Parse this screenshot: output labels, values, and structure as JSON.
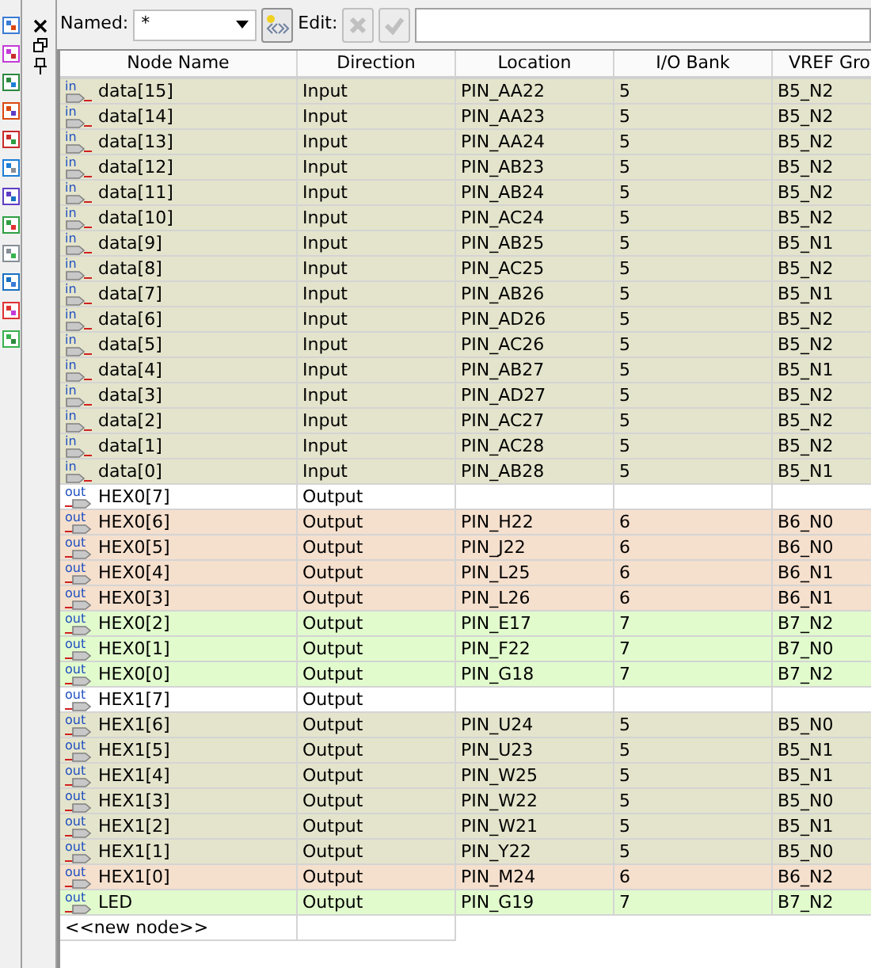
{
  "toolbar": {
    "named_label": "Named:",
    "named_value": "*",
    "edit_label": "Edit:"
  },
  "table": {
    "columns": [
      "Node Name",
      "Direction",
      "Location",
      "I/O Bank",
      "VREF Gro"
    ],
    "rows": [
      {
        "tag": "in",
        "name": "data[15]",
        "direction": "Input",
        "location": "PIN_AA22",
        "bank": "5",
        "vref": "B5_N2",
        "color": "#e4e4cc"
      },
      {
        "tag": "in",
        "name": "data[14]",
        "direction": "Input",
        "location": "PIN_AA23",
        "bank": "5",
        "vref": "B5_N2",
        "color": "#e4e4cc"
      },
      {
        "tag": "in",
        "name": "data[13]",
        "direction": "Input",
        "location": "PIN_AA24",
        "bank": "5",
        "vref": "B5_N2",
        "color": "#e4e4cc"
      },
      {
        "tag": "in",
        "name": "data[12]",
        "direction": "Input",
        "location": "PIN_AB23",
        "bank": "5",
        "vref": "B5_N2",
        "color": "#e4e4cc"
      },
      {
        "tag": "in",
        "name": "data[11]",
        "direction": "Input",
        "location": "PIN_AB24",
        "bank": "5",
        "vref": "B5_N2",
        "color": "#e4e4cc"
      },
      {
        "tag": "in",
        "name": "data[10]",
        "direction": "Input",
        "location": "PIN_AC24",
        "bank": "5",
        "vref": "B5_N2",
        "color": "#e4e4cc"
      },
      {
        "tag": "in",
        "name": "data[9]",
        "direction": "Input",
        "location": "PIN_AB25",
        "bank": "5",
        "vref": "B5_N1",
        "color": "#e4e4cc"
      },
      {
        "tag": "in",
        "name": "data[8]",
        "direction": "Input",
        "location": "PIN_AC25",
        "bank": "5",
        "vref": "B5_N2",
        "color": "#e4e4cc"
      },
      {
        "tag": "in",
        "name": "data[7]",
        "direction": "Input",
        "location": "PIN_AB26",
        "bank": "5",
        "vref": "B5_N1",
        "color": "#e4e4cc"
      },
      {
        "tag": "in",
        "name": "data[6]",
        "direction": "Input",
        "location": "PIN_AD26",
        "bank": "5",
        "vref": "B5_N2",
        "color": "#e4e4cc"
      },
      {
        "tag": "in",
        "name": "data[5]",
        "direction": "Input",
        "location": "PIN_AC26",
        "bank": "5",
        "vref": "B5_N2",
        "color": "#e4e4cc"
      },
      {
        "tag": "in",
        "name": "data[4]",
        "direction": "Input",
        "location": "PIN_AB27",
        "bank": "5",
        "vref": "B5_N1",
        "color": "#e4e4cc"
      },
      {
        "tag": "in",
        "name": "data[3]",
        "direction": "Input",
        "location": "PIN_AD27",
        "bank": "5",
        "vref": "B5_N2",
        "color": "#e4e4cc"
      },
      {
        "tag": "in",
        "name": "data[2]",
        "direction": "Input",
        "location": "PIN_AC27",
        "bank": "5",
        "vref": "B5_N2",
        "color": "#e4e4cc"
      },
      {
        "tag": "in",
        "name": "data[1]",
        "direction": "Input",
        "location": "PIN_AC28",
        "bank": "5",
        "vref": "B5_N2",
        "color": "#e4e4cc"
      },
      {
        "tag": "in",
        "name": "data[0]",
        "direction": "Input",
        "location": "PIN_AB28",
        "bank": "5",
        "vref": "B5_N1",
        "color": "#e4e4cc"
      },
      {
        "tag": "out",
        "name": "HEX0[7]",
        "direction": "Output",
        "color": "#ffffff"
      },
      {
        "tag": "out",
        "name": "HEX0[6]",
        "direction": "Output",
        "location": "PIN_H22",
        "bank": "6",
        "vref": "B6_N0",
        "color": "#f5dfcd"
      },
      {
        "tag": "out",
        "name": "HEX0[5]",
        "direction": "Output",
        "location": "PIN_J22",
        "bank": "6",
        "vref": "B6_N0",
        "color": "#f5dfcd"
      },
      {
        "tag": "out",
        "name": "HEX0[4]",
        "direction": "Output",
        "location": "PIN_L25",
        "bank": "6",
        "vref": "B6_N1",
        "color": "#f5dfcd"
      },
      {
        "tag": "out",
        "name": "HEX0[3]",
        "direction": "Output",
        "location": "PIN_L26",
        "bank": "6",
        "vref": "B6_N1",
        "color": "#f5dfcd"
      },
      {
        "tag": "out",
        "name": "HEX0[2]",
        "direction": "Output",
        "location": "PIN_E17",
        "bank": "7",
        "vref": "B7_N2",
        "color": "#e1fbcd"
      },
      {
        "tag": "out",
        "name": "HEX0[1]",
        "direction": "Output",
        "location": "PIN_F22",
        "bank": "7",
        "vref": "B7_N0",
        "color": "#e1fbcd"
      },
      {
        "tag": "out",
        "name": "HEX0[0]",
        "direction": "Output",
        "location": "PIN_G18",
        "bank": "7",
        "vref": "B7_N2",
        "color": "#e1fbcd"
      },
      {
        "tag": "out",
        "name": "HEX1[7]",
        "direction": "Output",
        "color": "#ffffff"
      },
      {
        "tag": "out",
        "name": "HEX1[6]",
        "direction": "Output",
        "location": "PIN_U24",
        "bank": "5",
        "vref": "B5_N0",
        "color": "#e4e4cc"
      },
      {
        "tag": "out",
        "name": "HEX1[5]",
        "direction": "Output",
        "location": "PIN_U23",
        "bank": "5",
        "vref": "B5_N1",
        "color": "#e4e4cc"
      },
      {
        "tag": "out",
        "name": "HEX1[4]",
        "direction": "Output",
        "location": "PIN_W25",
        "bank": "5",
        "vref": "B5_N1",
        "color": "#e4e4cc"
      },
      {
        "tag": "out",
        "name": "HEX1[3]",
        "direction": "Output",
        "location": "PIN_W22",
        "bank": "5",
        "vref": "B5_N0",
        "color": "#e4e4cc"
      },
      {
        "tag": "out",
        "name": "HEX1[2]",
        "direction": "Output",
        "location": "PIN_W21",
        "bank": "5",
        "vref": "B5_N1",
        "color": "#e4e4cc"
      },
      {
        "tag": "out",
        "name": "HEX1[1]",
        "direction": "Output",
        "location": "PIN_Y22",
        "bank": "5",
        "vref": "B5_N0",
        "color": "#e4e4cc"
      },
      {
        "tag": "out",
        "name": "HEX1[0]",
        "direction": "Output",
        "location": "PIN_M24",
        "bank": "6",
        "vref": "B6_N2",
        "color": "#f5dfcd"
      },
      {
        "tag": "out",
        "name": "LED",
        "direction": "Output",
        "location": "PIN_G19",
        "bank": "7",
        "vref": "B7_N2",
        "color": "#e1fbcd"
      }
    ],
    "new_row": "<<new node>>"
  }
}
